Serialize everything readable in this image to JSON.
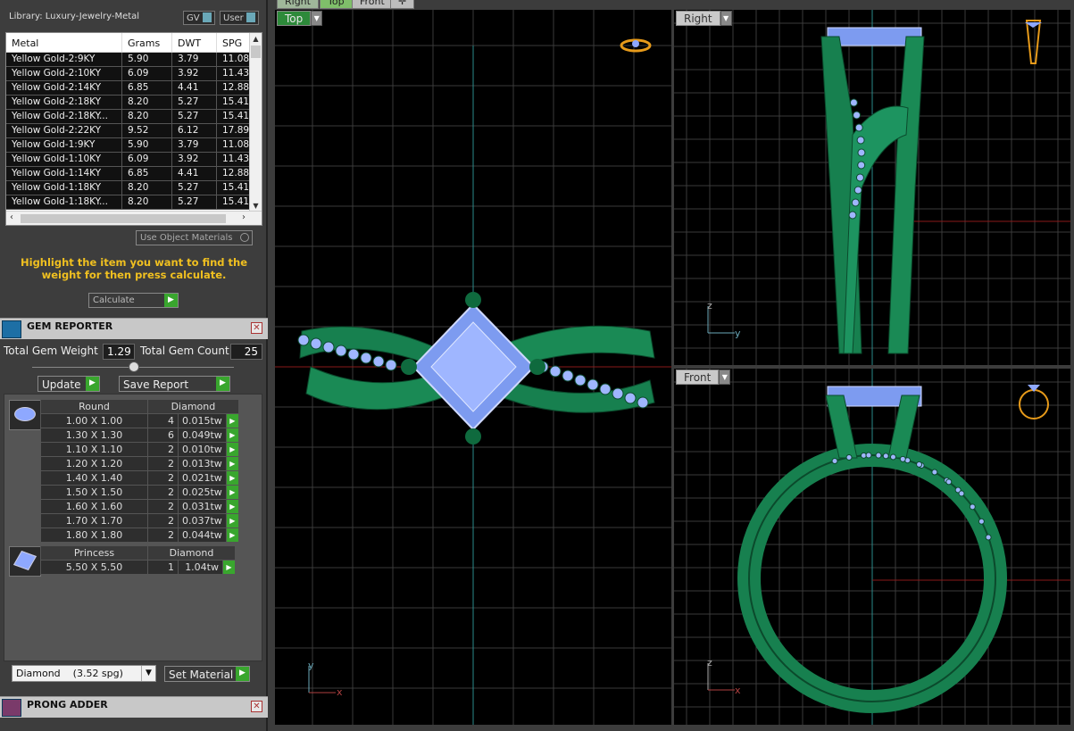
{
  "library": {
    "title": "Library: Luxury-Jewelry-Metal",
    "gv": "GV",
    "user": "User"
  },
  "metal_table": {
    "headers": [
      "Metal",
      "Grams",
      "DWT",
      "SPG"
    ],
    "rows": [
      [
        "Yellow Gold-2:9KY",
        "5.90",
        "3.79",
        "11.08"
      ],
      [
        "Yellow Gold-2:10KY",
        "6.09",
        "3.92",
        "11.43"
      ],
      [
        "Yellow Gold-2:14KY",
        "6.85",
        "4.41",
        "12.88"
      ],
      [
        "Yellow Gold-2:18KY",
        "8.20",
        "5.27",
        "15.41"
      ],
      [
        "Yellow Gold-2:18KY...",
        "8.20",
        "5.27",
        "15.41"
      ],
      [
        "Yellow Gold-2:22KY",
        "9.52",
        "6.12",
        "17.89"
      ],
      [
        "Yellow Gold-1:9KY",
        "5.90",
        "3.79",
        "11.08"
      ],
      [
        "Yellow Gold-1:10KY",
        "6.09",
        "3.92",
        "11.43"
      ],
      [
        "Yellow Gold-1:14KY",
        "6.85",
        "4.41",
        "12.88"
      ],
      [
        "Yellow Gold-1:18KY",
        "8.20",
        "5.27",
        "15.41"
      ],
      [
        "Yellow Gold-1:18KY...",
        "8.20",
        "5.27",
        "15.41"
      ]
    ]
  },
  "use_object_materials": "Use Object Materials",
  "hint": "Highlight the item you want to find the weight for then press calculate.",
  "calculate": "Calculate",
  "gem_reporter": {
    "title": "GEM REPORTER",
    "total_weight_label": "Total Gem Weight",
    "total_weight": "1.29",
    "total_count_label": "Total Gem Count",
    "total_count": "25",
    "update": "Update",
    "save_report": "Save Report",
    "round": {
      "shape": "Round",
      "material": "Diamond",
      "rows": [
        [
          "1.00 X 1.00",
          "4",
          "0.015tw"
        ],
        [
          "1.30 X 1.30",
          "6",
          "0.049tw"
        ],
        [
          "1.10 X 1.10",
          "2",
          "0.010tw"
        ],
        [
          "1.20 X 1.20",
          "2",
          "0.013tw"
        ],
        [
          "1.40 X 1.40",
          "2",
          "0.021tw"
        ],
        [
          "1.50 X 1.50",
          "2",
          "0.025tw"
        ],
        [
          "1.60 X 1.60",
          "2",
          "0.031tw"
        ],
        [
          "1.70 X 1.70",
          "2",
          "0.037tw"
        ],
        [
          "1.80 X 1.80",
          "2",
          "0.044tw"
        ]
      ]
    },
    "princess": {
      "shape": "Princess",
      "material": "Diamond",
      "rows": [
        [
          "5.50 X 5.50",
          "1",
          "1.04tw"
        ]
      ]
    },
    "material_select": "Diamond    (3.52 spg)",
    "set_material": "Set Material"
  },
  "prong_adder": {
    "title": "PRONG ADDER"
  },
  "top_tabs": [
    "Right",
    "Top",
    "Front"
  ],
  "viewports": {
    "top": "Top",
    "right": "Right",
    "front": "Front"
  },
  "axes": {
    "y": "y",
    "x": "x",
    "z": "z"
  }
}
